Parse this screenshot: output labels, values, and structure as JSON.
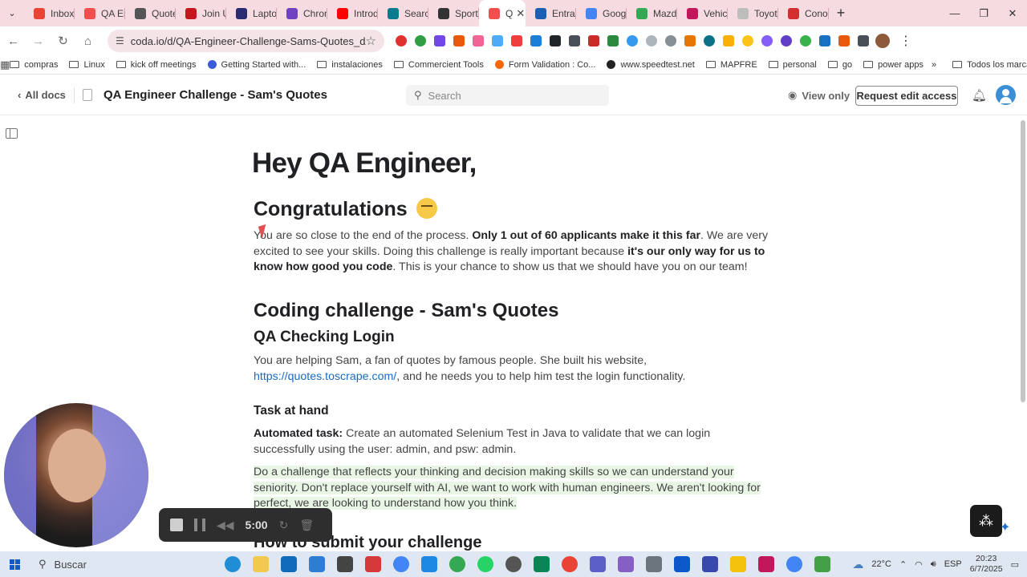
{
  "browser": {
    "tabs": [
      {
        "label": "Inbox",
        "color": "#ea4335"
      },
      {
        "label": "QA En",
        "color": "#f24e4e"
      },
      {
        "label": "Quote",
        "color": "#555555"
      },
      {
        "label": "Join U",
        "color": "#c4161c"
      },
      {
        "label": "Lapto",
        "color": "#2b2b72"
      },
      {
        "label": "Chron",
        "color": "#6f42c1"
      },
      {
        "label": "Introd",
        "color": "#ff0000"
      },
      {
        "label": "Search",
        "color": "#0a7b8c"
      },
      {
        "label": "Sporty",
        "color": "#333333"
      },
      {
        "label": "Q",
        "color": "#f24e4e",
        "active": true
      },
      {
        "label": "Entra",
        "color": "#1a5fb4"
      },
      {
        "label": "Googl",
        "color": "#4285f4"
      },
      {
        "label": "Mazda",
        "color": "#34a853"
      },
      {
        "label": "Vehic",
        "color": "#c2185b"
      },
      {
        "label": "Toyota",
        "color": "#bdbdbd"
      },
      {
        "label": "Conoc",
        "color": "#d32f2f"
      }
    ],
    "close_tab": "✕",
    "new_tab": "+",
    "url": "coda.io/d/QA-Engineer-Challenge-Sams-Quotes_dAkKw...",
    "window_controls": {
      "minimize": "—",
      "restore": "❐",
      "close": "✕"
    }
  },
  "bookmarks": [
    {
      "label": "compras",
      "type": "folder"
    },
    {
      "label": "Linux",
      "type": "folder"
    },
    {
      "label": "kick off meetings",
      "type": "folder"
    },
    {
      "label": "Getting Started with...",
      "type": "site",
      "color": "#3b5bdb"
    },
    {
      "label": "instalaciones",
      "type": "folder"
    },
    {
      "label": "Commercient Tools",
      "type": "folder"
    },
    {
      "label": "Form Validation : Co...",
      "type": "site",
      "color": "#f76707"
    },
    {
      "label": "www.speedtest.net",
      "type": "site",
      "color": "#222222"
    },
    {
      "label": "MAPFRE",
      "type": "folder"
    },
    {
      "label": "personal",
      "type": "folder"
    },
    {
      "label": "go",
      "type": "folder"
    },
    {
      "label": "power apps",
      "type": "folder"
    }
  ],
  "bookmarks_more": "»",
  "bookmarks_all": "Todos los marcadores",
  "coda": {
    "all_docs": "All docs",
    "doc_title": "QA Engineer Challenge - Sam's Quotes",
    "search_placeholder": "Search",
    "view_only": "View only",
    "request_edit": "Request edit access"
  },
  "doc": {
    "title": "Hey QA Engineer,",
    "congrats": "Congratulations",
    "intro": {
      "t1": "You are so close to the end of the process. ",
      "b1": "Only 1 out of 60 applicants make it this far",
      "t2": ". We are very excited to see your skills. Doing this challenge is really important because ",
      "b2": "it's our only way for us to know how good you code",
      "t3": ". This is your chance to show us that we should have you on our team!"
    },
    "coding_heading": "Coding challenge - Sam's Quotes",
    "qa_heading": "QA Checking Login",
    "helping": {
      "t1": "You are helping Sam, a fan of quotes by famous people. She built his website, ",
      "link": "https://quotes.toscrape.com/",
      "t2": ", and he needs you to help him test the login functionality."
    },
    "task_heading": "Task at hand",
    "automated": {
      "label": "Automated task:",
      "text": " Create an automated Selenium Test in Java to validate that we can login successfully using the user: admin, and psw: admin."
    },
    "highlight": "Do a challenge that reflects your thinking and decision making skills so we can understand your seniority. Don't replace yourself with AI, we want to work with human engineers. We aren't looking for perfect, we are looking to understand how you think.",
    "submit_heading": "How to submit your challenge"
  },
  "recorder": {
    "time": "5:00"
  },
  "taskbar": {
    "search": "Buscar",
    "weather": "22°C",
    "lang": "ESP",
    "time": "20:23",
    "date": "6/7/2025"
  }
}
